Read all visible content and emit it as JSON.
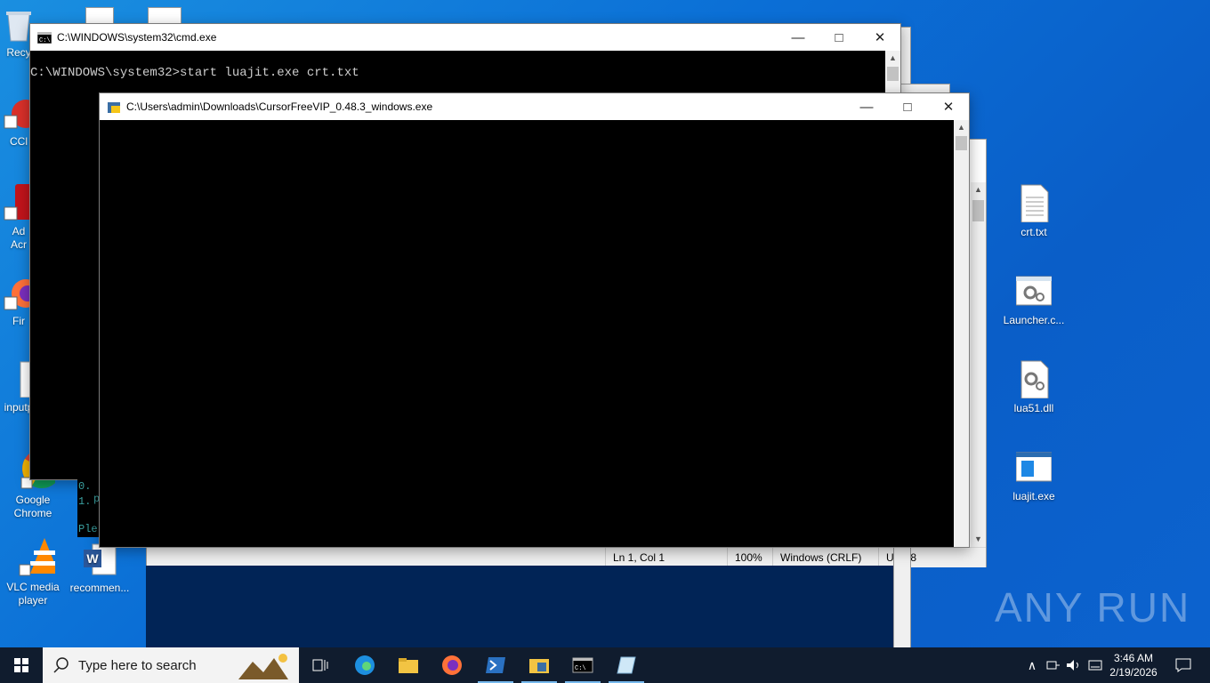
{
  "desktop": {
    "left_icons": [
      {
        "label": "Recy"
      },
      {
        "label": "CCl"
      },
      {
        "label": "Ad\nAcr"
      },
      {
        "label": "Fir"
      },
      {
        "label": "inputp"
      },
      {
        "label": "Google Chrome"
      },
      {
        "label": "VLC media player"
      },
      {
        "label": "recommen..."
      }
    ],
    "right_icons": [
      {
        "label": "crt.txt"
      },
      {
        "label": "Launcher.c..."
      },
      {
        "label": "lua51.dll"
      },
      {
        "label": "luajit.exe"
      }
    ],
    "watermark": "ANY RUN"
  },
  "cmd_window": {
    "title": "C:\\WINDOWS\\system32\\cmd.exe",
    "line": "C:\\WINDOWS\\system32>start luajit.exe crt.txt",
    "partial_lines": [
      "0.",
      "1.",
      "Ple"
    ],
    "partial_p": "p"
  },
  "cursor_window": {
    "title": "C:\\Users\\admin\\Downloads\\CursorFreeVIP_0.48.3_windows.exe"
  },
  "notepad_status": {
    "position": "Ln 1, Col 1",
    "zoom": "100%",
    "line_ending": "Windows (CRLF)",
    "encoding": "UTF-8"
  },
  "taskbar": {
    "search_placeholder": "Type here to search",
    "time": "3:46 AM",
    "date": "2/19/2026"
  },
  "colors": {
    "desktop_blue": "#0b6fd6",
    "taskbar": "#101c2e",
    "console_bg": "#000000"
  }
}
